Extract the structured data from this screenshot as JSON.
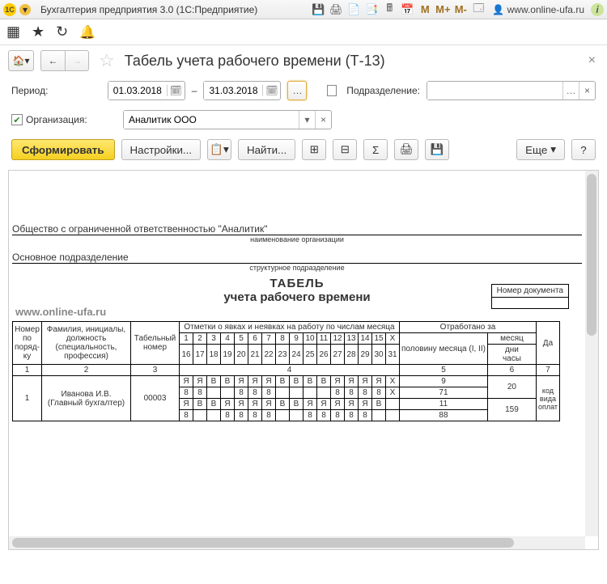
{
  "titlebar": {
    "logo": "1C",
    "app_title": "Бухгалтерия предприятия 3.0   (1С:Предприятие)",
    "m1": "М",
    "m2": "М+",
    "m3": "М-",
    "user_prefix": "👤",
    "user": "www.online-ufa.ru"
  },
  "header": {
    "title": "Табель учета рабочего времени (Т-13)"
  },
  "form": {
    "period_label": "Период:",
    "date_from": "01.03.2018",
    "date_to": "31.03.2018",
    "dash": "–",
    "division_label": "Подразделение:",
    "division_value": "",
    "org_label": "Организация:",
    "org_value": "Аналитик ООО"
  },
  "toolbar": {
    "generate": "Сформировать",
    "settings": "Настройки...",
    "find": "Найти...",
    "sum": "Σ",
    "more": "Еще",
    "help": "?"
  },
  "doc": {
    "org_full": "Общество с ограниченной ответственностью \"Аналитик\"",
    "org_caption": "наименование организации",
    "division": "Основное подразделение",
    "division_caption": "структурное подразделение",
    "title1": "ТАБЕЛЬ",
    "title2": "учета  рабочего времени",
    "watermark": "www.online-ufa.ru",
    "num_label": "Номер документа",
    "num_value": ""
  },
  "table": {
    "h_num": "Номер по поряд-ку",
    "h_fio": "Фамилия, инициалы, должность (специальность, профессия)",
    "h_tabnum": "Табельный номер",
    "h_marks": "Отметки о явках и неявках на работу по числам месяца",
    "h_worked": "Отработано за",
    "h_half": "половину месяца (I, II)",
    "h_month": "месяц",
    "h_days": "дни",
    "h_hours": "часы",
    "h_pay": "код вида оплат",
    "h_da": "Да",
    "days1": [
      "1",
      "2",
      "3",
      "4",
      "5",
      "6",
      "7",
      "8",
      "9",
      "10",
      "11",
      "12",
      "13",
      "14",
      "15",
      "Х"
    ],
    "days2": [
      "16",
      "17",
      "18",
      "19",
      "20",
      "21",
      "22",
      "23",
      "24",
      "25",
      "26",
      "27",
      "28",
      "29",
      "30",
      "31"
    ],
    "colnums": {
      "c1": "1",
      "c2": "2",
      "c3": "3",
      "c4": "4",
      "c5": "5",
      "c6": "6",
      "c7": "7"
    },
    "row": {
      "num": "1",
      "fio": "Иванова И.В. (Главный бухгалтер)",
      "tabnum": "00003",
      "r1": [
        "Я",
        "Я",
        "В",
        "В",
        "Я",
        "Я",
        "Я",
        "В",
        "В",
        "В",
        "В",
        "Я",
        "Я",
        "Я",
        "Я",
        "Х"
      ],
      "r2": [
        "8",
        "8",
        "",
        "",
        "8",
        "8",
        "8",
        "",
        "",
        "",
        "",
        "8",
        "8",
        "8",
        "8",
        "Х"
      ],
      "r3": [
        "Я",
        "В",
        "В",
        "Я",
        "Я",
        "Я",
        "Я",
        "В",
        "В",
        "Я",
        "Я",
        "Я",
        "Я",
        "Я",
        "В",
        ""
      ],
      "r4": [
        "8",
        "",
        "",
        "8",
        "8",
        "8",
        "8",
        "",
        "",
        "8",
        "8",
        "8",
        "8",
        "8",
        "",
        ""
      ],
      "half1_d": "9",
      "half2_d": "71",
      "month_d": "20",
      "half3_d": "11",
      "half4_d": "88",
      "month_h": "159"
    }
  }
}
